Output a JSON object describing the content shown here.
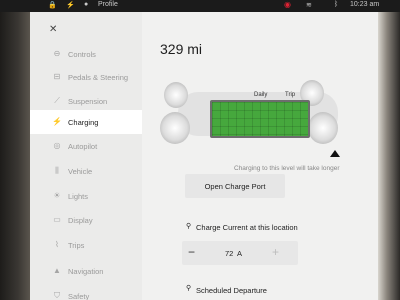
{
  "status_bar": {
    "profile_label": "Profile",
    "time": "10:23 am"
  },
  "sidebar": {
    "items": [
      {
        "label": "Controls",
        "icon": "toggle-icon"
      },
      {
        "label": "Pedals & Steering",
        "icon": "car-icon"
      },
      {
        "label": "Suspension",
        "icon": "suspension-icon"
      },
      {
        "label": "Charging",
        "icon": "bolt-icon"
      },
      {
        "label": "Autopilot",
        "icon": "steering-wheel-icon"
      },
      {
        "label": "Vehicle",
        "icon": "sliders-icon"
      },
      {
        "label": "Lights",
        "icon": "sun-icon"
      },
      {
        "label": "Display",
        "icon": "display-icon"
      },
      {
        "label": "Trips",
        "icon": "trips-icon"
      },
      {
        "label": "Navigation",
        "icon": "navigation-arrow-icon"
      },
      {
        "label": "Safety",
        "icon": "shield-icon"
      }
    ],
    "active_index": 3
  },
  "charging": {
    "range": "329 mi",
    "scale_daily": "Daily",
    "scale_trip": "Trip",
    "longer_note": "Charging to this level will take longer",
    "open_charge_port_label": "Open Charge Port",
    "charge_current_label": "Charge Current at this location",
    "charge_current_value": "72",
    "charge_current_unit": "A",
    "scheduled_departure_label": "Scheduled Departure"
  },
  "colors": {
    "battery_green": "#46a83d",
    "active_item_bg": "#ffffff"
  }
}
